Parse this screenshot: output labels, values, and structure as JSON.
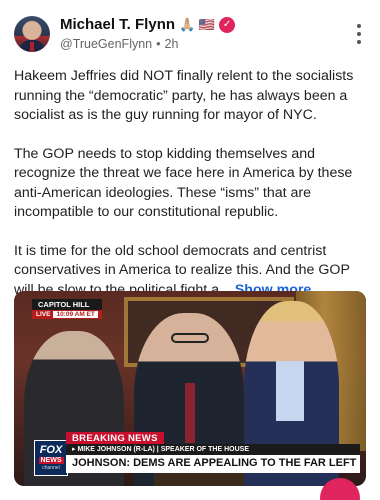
{
  "author": {
    "name": "Michael T. Flynn",
    "badges": "🙏🏼 🇺🇸",
    "handle": "@TrueGenFlynn",
    "separator": "•",
    "time": "2h"
  },
  "post": {
    "paragraphs": [
      "Hakeem Jeffries did NOT finally relent to the socialists running the “democratic” party, he has always been a socialist as is the guy running for mayor of NYC.",
      "The GOP needs to stop kidding themselves and recognize the threat we face here in America by these anti-American ideologies. These “isms” that are incompatible to our constitutional republic.",
      "It is time for the old school democrats and centrist conservatives in America to realize this. And the GOP will be slow to the political fight a..."
    ],
    "show_more": "Show more"
  },
  "media": {
    "location_tag": "CAPITOL HILL",
    "live_label": "LIVE",
    "time_label": "10:09 AM ET",
    "breaking_label": "BREAKING NEWS",
    "speaker_line": "▸ MIKE JOHNSON (R-LA)  |  SPEAKER OF THE HOUSE",
    "headline": "JOHNSON: DEMS ARE APPEALING TO THE FAR LEFT",
    "logo_top": "FOX",
    "logo_bottom": "NEWS",
    "logo_sub": "channel"
  },
  "icons": {
    "verified": "verified-badge-icon",
    "menu": "more-vertical-icon"
  },
  "colors": {
    "link": "#1d63d6",
    "verified": "#e0245e",
    "breaking": "#c8102e"
  }
}
